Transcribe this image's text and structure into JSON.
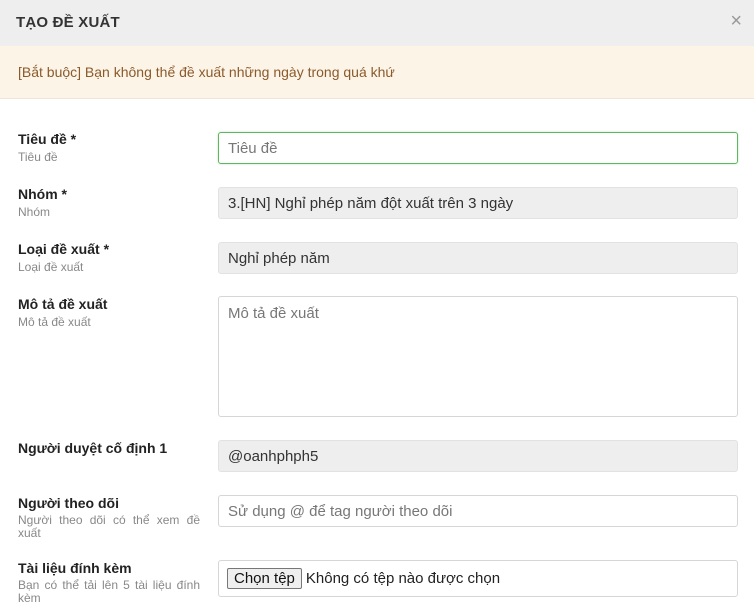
{
  "dialog": {
    "title": "TẠO ĐỀ XUẤT",
    "close_icon": "×"
  },
  "notice": "[Bắt buộc] Bạn không thể đề xuất những ngày trong quá khứ",
  "fields": {
    "title": {
      "label": "Tiêu đề *",
      "sub": "Tiêu đề",
      "placeholder": "Tiêu đề"
    },
    "group": {
      "label": "Nhóm *",
      "sub": "Nhóm",
      "value": "3.[HN] Nghỉ phép năm đột xuất trên 3 ngày"
    },
    "type": {
      "label": "Loại đề xuất *",
      "sub": "Loại đề xuất",
      "value": "Nghỉ phép năm"
    },
    "description": {
      "label": "Mô tả đề xuất",
      "sub": "Mô tả đề xuất",
      "placeholder": "Mô tả đề xuất"
    },
    "approver": {
      "label": "Người duyệt cố định 1",
      "value": "@oanhphph5"
    },
    "followers": {
      "label": "Người theo dõi",
      "sub": "Người theo dõi có thể xem đề xuất",
      "placeholder": "Sử dụng @ để tag người theo dõi"
    },
    "attachments": {
      "label": "Tài liệu đính kèm",
      "sub": "Bạn có thể tải lên 5 tài liệu đính kèm",
      "button": "Chọn tệp",
      "status": "Không có tệp nào được chọn"
    }
  },
  "colors": {
    "focus_border": "#5cb85c",
    "notice_bg": "#fdf4e8",
    "notice_text": "#8a5a2b"
  }
}
